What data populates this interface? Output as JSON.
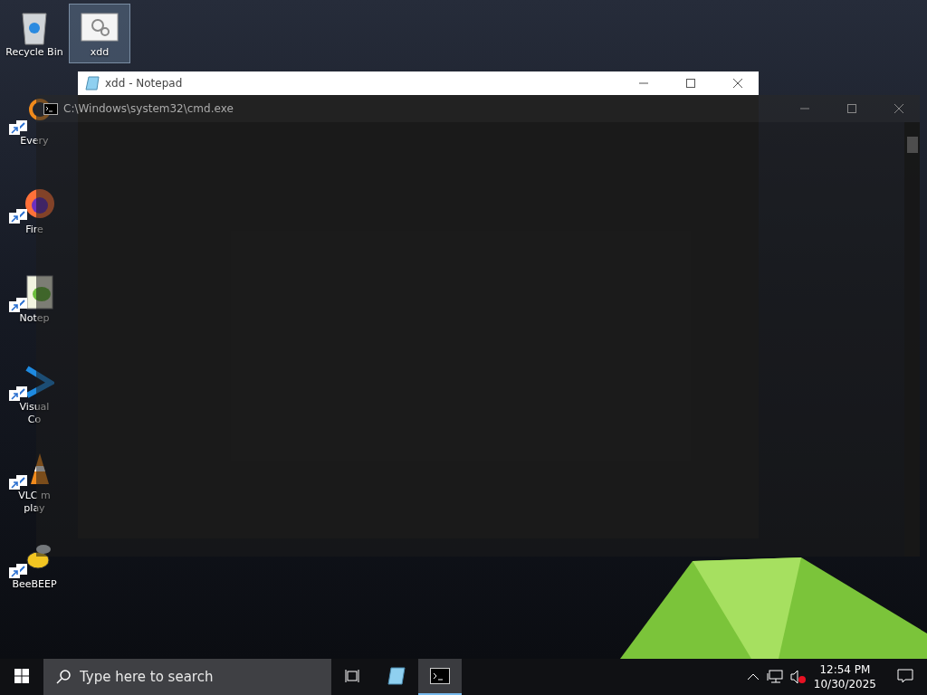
{
  "desktop_icons": [
    {
      "kind": "recycle",
      "lines": [
        "Recycle Bin"
      ],
      "selected": false,
      "shortcut": false
    },
    {
      "kind": "file",
      "lines": [
        "xdd"
      ],
      "selected": true,
      "shortcut": false
    },
    {
      "kind": "everything",
      "lines": [
        "Every"
      ],
      "selected": false,
      "shortcut": true
    },
    {
      "kind": "firefox",
      "lines": [
        "Fire"
      ],
      "selected": false,
      "shortcut": true
    },
    {
      "kind": "notepadpp",
      "lines": [
        "Notep"
      ],
      "selected": false,
      "shortcut": true
    },
    {
      "kind": "vscode",
      "lines": [
        "Visual",
        "Co"
      ],
      "selected": false,
      "shortcut": true
    },
    {
      "kind": "vlc",
      "lines": [
        "VLC m",
        "play"
      ],
      "selected": false,
      "shortcut": true
    },
    {
      "kind": "beebeep",
      "lines": [
        "BeeBEEP"
      ],
      "selected": false,
      "shortcut": true
    }
  ],
  "notepad_window": {
    "title": "xdd - Notepad"
  },
  "cmd_window": {
    "title": "C:\\Windows\\system32\\cmd.exe"
  },
  "taskbar": {
    "search_placeholder": "Type here to search",
    "apps": [
      {
        "kind": "notepad",
        "selected": false
      },
      {
        "kind": "cmd",
        "selected": true
      }
    ],
    "time": "12:54 PM",
    "date": "10/30/2025"
  }
}
